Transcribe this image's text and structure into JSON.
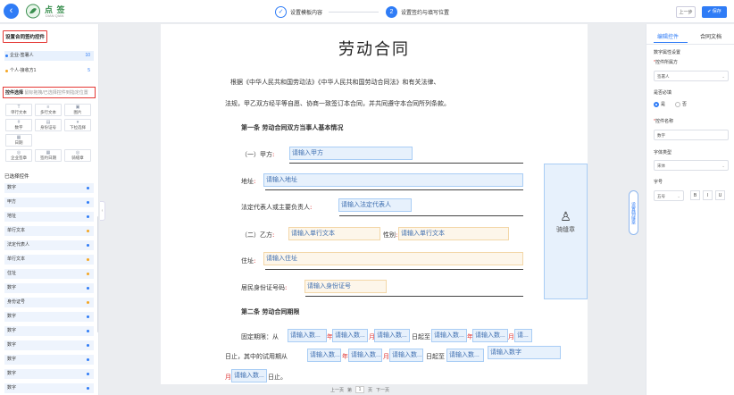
{
  "header": {
    "back_icon": "arrow-left-icon",
    "logo_icon": "leaf-logo",
    "brand": "点 签",
    "brand_sub": "DIAN QIAN",
    "steps": [
      {
        "label": "设置模板内容",
        "mark": "✓"
      },
      {
        "label": "设置签约与填写位置",
        "mark": "2"
      }
    ],
    "prev_label": "上一步",
    "save_label": "✔ 保存"
  },
  "left": {
    "section_title": "设置合同签约控件",
    "parties": [
      {
        "label": "企业-签署人",
        "count": "10"
      },
      {
        "label": "个人-接收方1",
        "count": "5"
      }
    ],
    "controls_title": "控件选择",
    "controls_hint": "鼠标拖拽/已选择控件到指定位置",
    "controls": [
      {
        "label": "单行文本",
        "icon": "T"
      },
      {
        "label": "多行文本",
        "icon": "≡"
      },
      {
        "label": "图片",
        "icon": "▣"
      },
      {
        "label": "数字",
        "icon": "#"
      },
      {
        "label": "身份证号",
        "icon": "▤"
      },
      {
        "label": "下拉选择",
        "icon": "▾"
      },
      {
        "label": "日期",
        "icon": "▦"
      },
      {
        "label": "企业签章",
        "icon": "◎"
      },
      {
        "label": "签约日期",
        "icon": "▦"
      },
      {
        "label": "骑缝章",
        "icon": "◎"
      }
    ],
    "used_title": "已选择控件",
    "used": [
      {
        "label": "数字",
        "color": "#2f7cf6"
      },
      {
        "label": "甲方",
        "color": "#2f7cf6"
      },
      {
        "label": "地址",
        "color": "#2f7cf6"
      },
      {
        "label": "单行文本",
        "color": "#f5a623"
      },
      {
        "label": "法定代表人",
        "color": "#2f7cf6"
      },
      {
        "label": "单行文本",
        "color": "#f5a623"
      },
      {
        "label": "住址",
        "color": "#f5a623"
      },
      {
        "label": "数字",
        "color": "#2f7cf6"
      },
      {
        "label": "身份证号",
        "color": "#f5a623"
      },
      {
        "label": "数字",
        "color": "#2f7cf6"
      },
      {
        "label": "数字",
        "color": "#2f7cf6"
      },
      {
        "label": "数字",
        "color": "#2f7cf6"
      },
      {
        "label": "数字",
        "color": "#2f7cf6"
      },
      {
        "label": "数字",
        "color": "#2f7cf6"
      },
      {
        "label": "数字",
        "color": "#2f7cf6"
      }
    ]
  },
  "doc": {
    "title": "劳动合同",
    "intro1": "根据《中华人民共和国劳动法》《中华人民共和国劳动合同法》和有关法律、",
    "intro2": "法规，甲乙双方经平等自愿、协商一致签订本合同，并共同遵守本合同所列条款。",
    "art1": "第一条  劳动合同双方当事人基本情况",
    "partyA": "（一）甲方",
    "address": "地址",
    "legal_rep": "法定代表人或主要负责人",
    "partyB": "（二）乙方",
    "gender": "性别",
    "residence": "住址",
    "idno": "居民身份证号码",
    "art2": "第二条  劳动合同期限",
    "fixed_term": "固定期限：从",
    "year": "年",
    "month": "月",
    "day": "日",
    "day_from": "日起至",
    "trial": "日止，其中的试用期从",
    "day_end": "日起至",
    "day_stop": "日止。",
    "ph_partyA": "请输入甲方",
    "ph_address": "请输入地址",
    "ph_legal": "请输入法定代表人",
    "ph_single": "请输入单行文本",
    "ph_residence": "请输入住址",
    "ph_id": "请输入身份证号",
    "ph_num": "请输入数...",
    "ph_num2": "请...",
    "ph_num_full": "请输入数字",
    "seal_label": "骑缝章",
    "seal_icon": "seal-person-icon"
  },
  "pager": {
    "prev": "上一页",
    "page_label": "第",
    "page": "1",
    "page_suffix": "页",
    "next": "下一页"
  },
  "sidebar_tab": "设置骑缝章",
  "right": {
    "tabs": [
      "编辑控件",
      "合同文档"
    ],
    "attr_title": "数字属性设置",
    "owner_label": "控件所属方",
    "owner_value": "签署人",
    "required_label": "是否必填",
    "yes": "是",
    "no": "否",
    "name_label": "控件名称",
    "name_value": "数字",
    "font_label": "字体类型",
    "font_value": "宋体",
    "size_label": "字号",
    "size_value": "五号",
    "bold": "B",
    "italic": "I",
    "underline": "U"
  }
}
